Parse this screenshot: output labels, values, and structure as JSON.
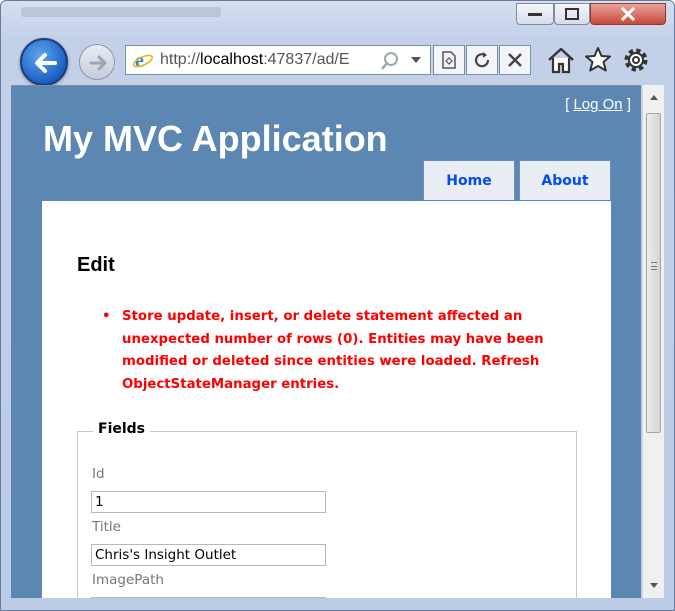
{
  "browser": {
    "url_prefix": "http://",
    "url_host": "localhost",
    "url_rest": ":47837/ad/E"
  },
  "site": {
    "title": "My MVC Application",
    "logon_open": "[",
    "logon_label": "Log On",
    "logon_close": "]",
    "menu": [
      {
        "label": "Home"
      },
      {
        "label": "About"
      }
    ]
  },
  "page": {
    "heading": "Edit",
    "errors": [
      "Store update, insert, or delete statement affected an unexpected number of rows (0). Entities may have been modified or deleted since entities were loaded. Refresh ObjectStateManager entries."
    ],
    "fieldset_legend": "Fields",
    "fields": [
      {
        "label": "Id",
        "value": "1"
      },
      {
        "label": "Title",
        "value": "Chris's Insight Outlet"
      },
      {
        "label": "ImagePath",
        "value": ""
      }
    ]
  },
  "colors": {
    "page_bg": "#5c87b2",
    "menu_link": "#034af3",
    "error": "#ff0000"
  },
  "icons": [
    "back-arrow-icon",
    "forward-arrow-icon",
    "ie-logo-icon",
    "search-icon",
    "dropdown-icon",
    "compatibility-view-icon",
    "refresh-icon",
    "stop-icon",
    "home-icon",
    "favorites-star-icon",
    "tools-gear-icon",
    "minimize-icon",
    "maximize-icon",
    "close-icon"
  ]
}
